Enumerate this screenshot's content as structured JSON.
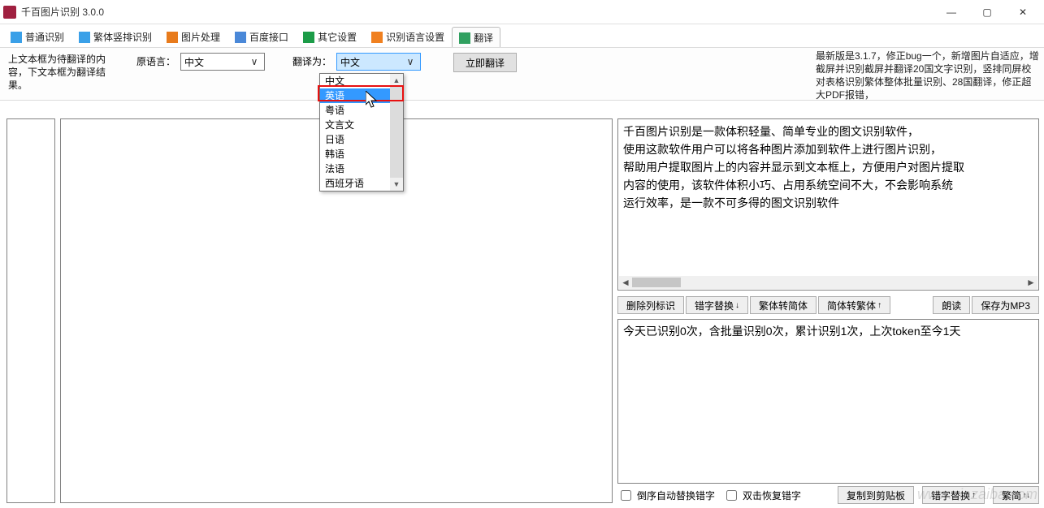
{
  "window": {
    "title": "千百图片识别 3.0.0"
  },
  "winbtns": {
    "min": "—",
    "max": "▢",
    "close": "✕"
  },
  "tabs": [
    {
      "label": "普通识别"
    },
    {
      "label": "繁体竖排识别"
    },
    {
      "label": "图片处理"
    },
    {
      "label": "百度接口"
    },
    {
      "label": "其它设置"
    },
    {
      "label": "识别语言设置"
    },
    {
      "label": "翻译",
      "active": true
    }
  ],
  "toolbar": {
    "instruction": "上文本框为待翻译的内容，下文本框为翻译结果。",
    "src_lang_label": "原语言：",
    "src_lang_value": "中文",
    "tgt_lang_label": "翻译为：",
    "tgt_lang_value": "中文",
    "translate_btn": "立即翻译"
  },
  "dropdown_options": [
    "中文",
    "英语",
    "粤语",
    "文言文",
    "日语",
    "韩语",
    "法语",
    "西班牙语"
  ],
  "dropdown_highlight_index": 1,
  "news": "最新版是3.1.7，修正bug一个，新增图片自适应，增截屏并识别截屏并翻译20国文字识别，竖排同屏校对表格识别繁体整体批量识别、28国翻译，修正超大PDF报错，",
  "right_top_text": "千百图片识别是一款体积轻量、简单专业的图文识别软件，\n使用这款软件用户可以将各种图片添加到软件上进行图片识别，\n帮助用户提取图片上的内容并显示到文本框上，方便用户对图片提取\n内容的使用，该软件体积小巧、占用系统空间不大，不会影响系统\n运行效率，是一款不可多得的图文识别软件",
  "right_btns": {
    "b1": "删除列标识",
    "b2": "错字替换",
    "b3": "繁体转简体",
    "b4": "简体转繁体",
    "b5": "朗读",
    "b6": "保存为MP3"
  },
  "right_mid_text": "今天已识别0次，含批量识别0次，累计识别1次，上次token至今1天",
  "bottom": {
    "chk1": "倒序自动替换错字",
    "chk2": "双击恢复错字",
    "b1": "复制到剪贴板",
    "b2": "错字替换",
    "b3": "繁简"
  },
  "watermark": "www.xiazaiba.com"
}
